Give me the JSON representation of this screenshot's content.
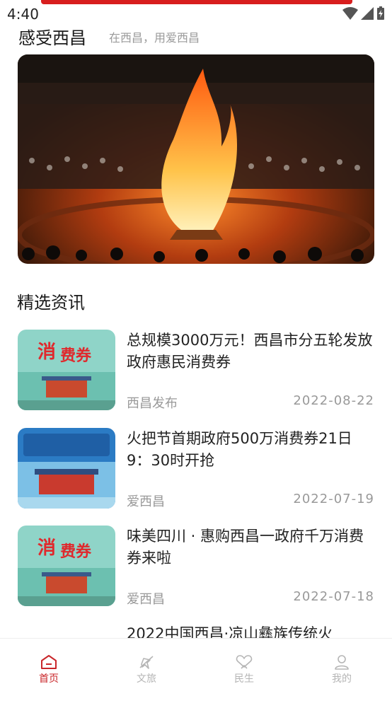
{
  "status_bar": {
    "time": "4:40"
  },
  "header": {
    "title": "感受西昌",
    "subtitle": "在西昌，用爱西昌"
  },
  "news": {
    "section_title": "精选资讯",
    "items": [
      {
        "title": "总规模3000万元！西昌市分五轮发放政府惠民消费券",
        "source": "西昌发布",
        "date": "2022-08-22"
      },
      {
        "title": "火把节首期政府500万消费券21日9：30时开抢",
        "source": "爱西昌",
        "date": "2022-07-19"
      },
      {
        "title": "味美四川 · 惠购西昌一政府千万消费券来啦",
        "source": "爱西昌",
        "date": "2022-07-18"
      },
      {
        "title": "2022中国西昌·凉山彝族传统火"
      }
    ]
  },
  "tabbar": {
    "accent": "#c9262a",
    "inactive": "#b5b5b5",
    "tabs": [
      {
        "label": "首页",
        "icon": "home-icon"
      },
      {
        "label": "文旅",
        "icon": "plane-icon"
      },
      {
        "label": "民生",
        "icon": "heart-hands-icon"
      },
      {
        "label": "我的",
        "icon": "user-icon"
      }
    ]
  }
}
